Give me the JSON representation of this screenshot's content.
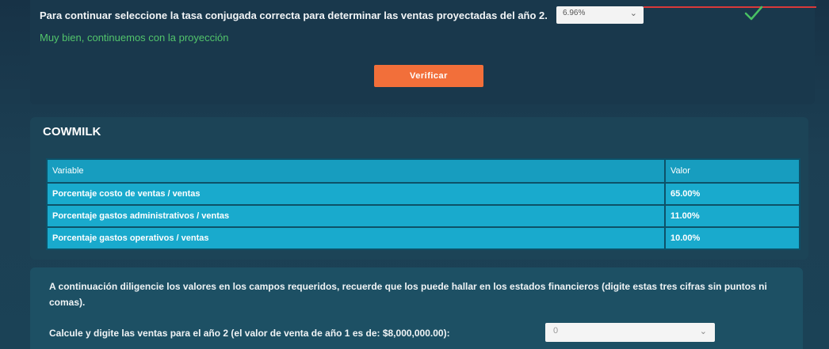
{
  "question": {
    "text": "Para continuar seleccione la tasa conjugada correcta para determinar las ventas proyectadas del año 2.",
    "selected_value": "6.96%",
    "success_message": "Muy bien, continuemos con la proyección"
  },
  "verify_button": {
    "label": "Verificar"
  },
  "cowmilk": {
    "title": "COWMILK",
    "table": {
      "headers": [
        "Variable",
        "Valor"
      ],
      "rows": [
        [
          "Porcentaje costo de ventas / ventas",
          "65.00%"
        ],
        [
          "Porcentaje gastos administrativos / ventas",
          "11.00%"
        ],
        [
          "Porcentaje gastos operativos / ventas",
          "10.00%"
        ]
      ]
    }
  },
  "instructions": {
    "text": "A continuación diligencie los valores en los campos requeridos, recuerde que los puede hallar en los estados financieros (digite estas tres cifras sin puntos ni comas).",
    "calc_label": "Calcule y digite las ventas para el año 2 (el valor de venta de año 1 es de: $8,000,000.00):",
    "input_value": "0"
  },
  "colors": {
    "accent_orange": "#f26f3a",
    "success_green": "#52c46b",
    "table_cyan": "#19aacd",
    "error_red": "#d9393a"
  }
}
